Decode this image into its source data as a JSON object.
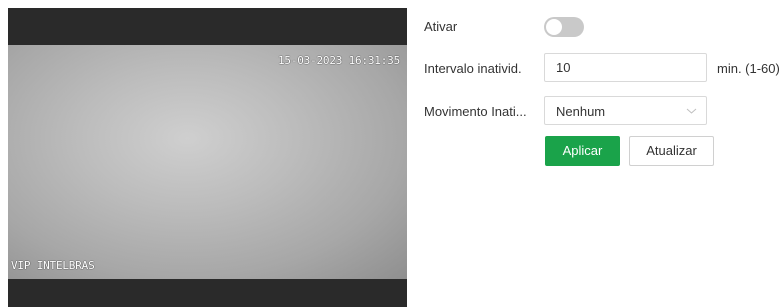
{
  "video": {
    "timestamp": "15-03-2023 16:31:35",
    "channel_name": "VIP INTELBRAS"
  },
  "form": {
    "enable_label": "Ativar",
    "enable_state": "off",
    "interval_label": "Intervalo inativid.",
    "interval_value": "10",
    "interval_unit": "min. (1-60)",
    "motion_label": "Movimento Inati...",
    "motion_value": "Nenhum"
  },
  "buttons": {
    "apply": "Aplicar",
    "refresh": "Atualizar"
  },
  "colors": {
    "accent": "#1aa34a",
    "toggle_off": "#c9c9c9"
  }
}
